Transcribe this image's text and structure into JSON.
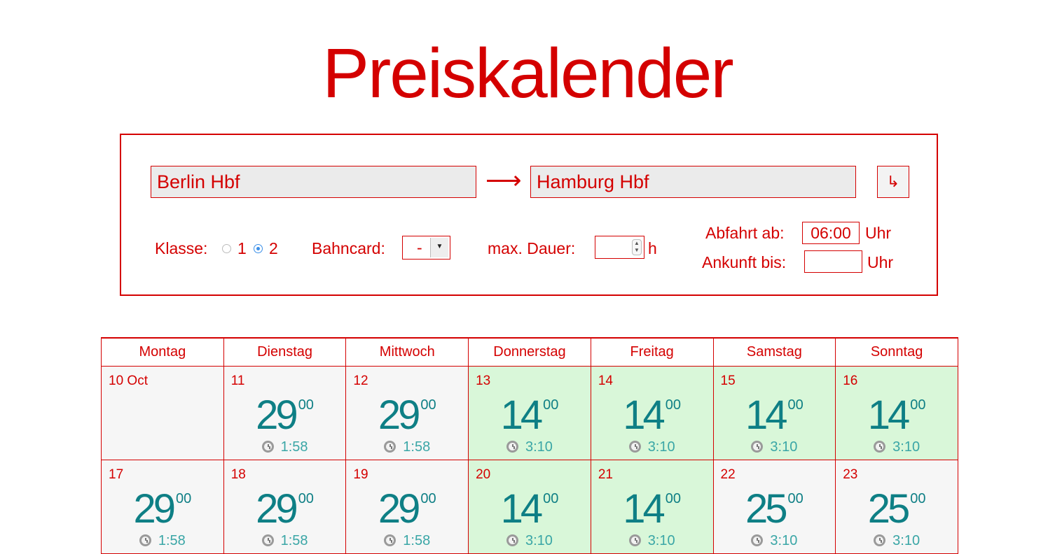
{
  "title": "Preiskalender",
  "search": {
    "from": "Berlin Hbf",
    "arrow": "⟶",
    "to": "Hamburg Hbf",
    "go_symbol": "↳"
  },
  "options": {
    "klasse_label": "Klasse:",
    "klasse_1": "1",
    "klasse_2": "2",
    "klasse_selected": "2",
    "bahncard_label": "Bahncard:",
    "bahncard_value": "-",
    "max_dauer_label": "max. Dauer:",
    "max_dauer_value": "",
    "max_dauer_unit": "h",
    "abfahrt_label": "Abfahrt ab:",
    "abfahrt_value": "06:00",
    "abfahrt_unit": "Uhr",
    "ankunft_label": "Ankunft bis:",
    "ankunft_value": "",
    "ankunft_unit": "Uhr"
  },
  "colors": {
    "accent": "#d40000",
    "price": "#0e7f85",
    "cheap_bg": "#d9f7d9",
    "default_bg": "#f6f6f6"
  },
  "calendar": {
    "weekdays": [
      "Montag",
      "Dienstag",
      "Mittwoch",
      "Donnerstag",
      "Freitag",
      "Samstag",
      "Sonntag"
    ],
    "weeks": [
      [
        {
          "date": "10 Oct",
          "euros": "",
          "cents": "",
          "duration": "",
          "cheap": false
        },
        {
          "date": "11",
          "euros": "29",
          "cents": "00",
          "duration": "1:58",
          "cheap": false
        },
        {
          "date": "12",
          "euros": "29",
          "cents": "00",
          "duration": "1:58",
          "cheap": false
        },
        {
          "date": "13",
          "euros": "14",
          "cents": "00",
          "duration": "3:10",
          "cheap": true
        },
        {
          "date": "14",
          "euros": "14",
          "cents": "00",
          "duration": "3:10",
          "cheap": true
        },
        {
          "date": "15",
          "euros": "14",
          "cents": "00",
          "duration": "3:10",
          "cheap": true
        },
        {
          "date": "16",
          "euros": "14",
          "cents": "00",
          "duration": "3:10",
          "cheap": true
        }
      ],
      [
        {
          "date": "17",
          "euros": "29",
          "cents": "00",
          "duration": "1:58",
          "cheap": false
        },
        {
          "date": "18",
          "euros": "29",
          "cents": "00",
          "duration": "1:58",
          "cheap": false
        },
        {
          "date": "19",
          "euros": "29",
          "cents": "00",
          "duration": "1:58",
          "cheap": false
        },
        {
          "date": "20",
          "euros": "14",
          "cents": "00",
          "duration": "3:10",
          "cheap": true
        },
        {
          "date": "21",
          "euros": "14",
          "cents": "00",
          "duration": "3:10",
          "cheap": true
        },
        {
          "date": "22",
          "euros": "25",
          "cents": "00",
          "duration": "3:10",
          "cheap": false
        },
        {
          "date": "23",
          "euros": "25",
          "cents": "00",
          "duration": "3:10",
          "cheap": false
        }
      ]
    ]
  }
}
